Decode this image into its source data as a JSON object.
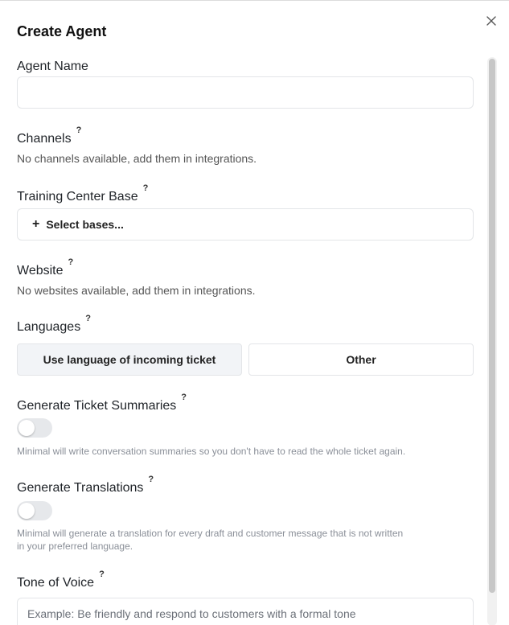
{
  "dialog": {
    "title": "Create Agent",
    "close_icon": "close-icon"
  },
  "agent_name": {
    "label": "Agent Name",
    "value": "",
    "placeholder": ""
  },
  "channels": {
    "label": "Channels",
    "help": "?",
    "empty_text": "No channels available, add them in integrations."
  },
  "training_center": {
    "label": "Training Center Base",
    "help": "?",
    "button_icon": "plus-icon",
    "button_label": "Select bases..."
  },
  "website": {
    "label": "Website",
    "help": "?",
    "empty_text": "No websites available, add them in integrations."
  },
  "languages": {
    "label": "Languages",
    "help": "?",
    "options": [
      {
        "label": "Use language of incoming ticket",
        "selected": true
      },
      {
        "label": "Other",
        "selected": false
      }
    ]
  },
  "ticket_summaries": {
    "label": "Generate Ticket Summaries",
    "help": "?",
    "enabled": false,
    "description": "Minimal will write conversation summaries so you don't have to read the whole ticket again."
  },
  "translations": {
    "label": "Generate Translations",
    "help": "?",
    "enabled": false,
    "description_line1": "Minimal will generate a translation for every draft and customer message that is not written",
    "description_line2": "in your preferred language."
  },
  "tone_of_voice": {
    "label": "Tone of Voice",
    "help": "?",
    "value": "",
    "placeholder": "Example: Be friendly and respond to customers with a formal tone"
  },
  "colors": {
    "toggle_off": "#e6e8eb",
    "selected_segment": "#f2f4f7",
    "border": "#e3e5e8"
  }
}
